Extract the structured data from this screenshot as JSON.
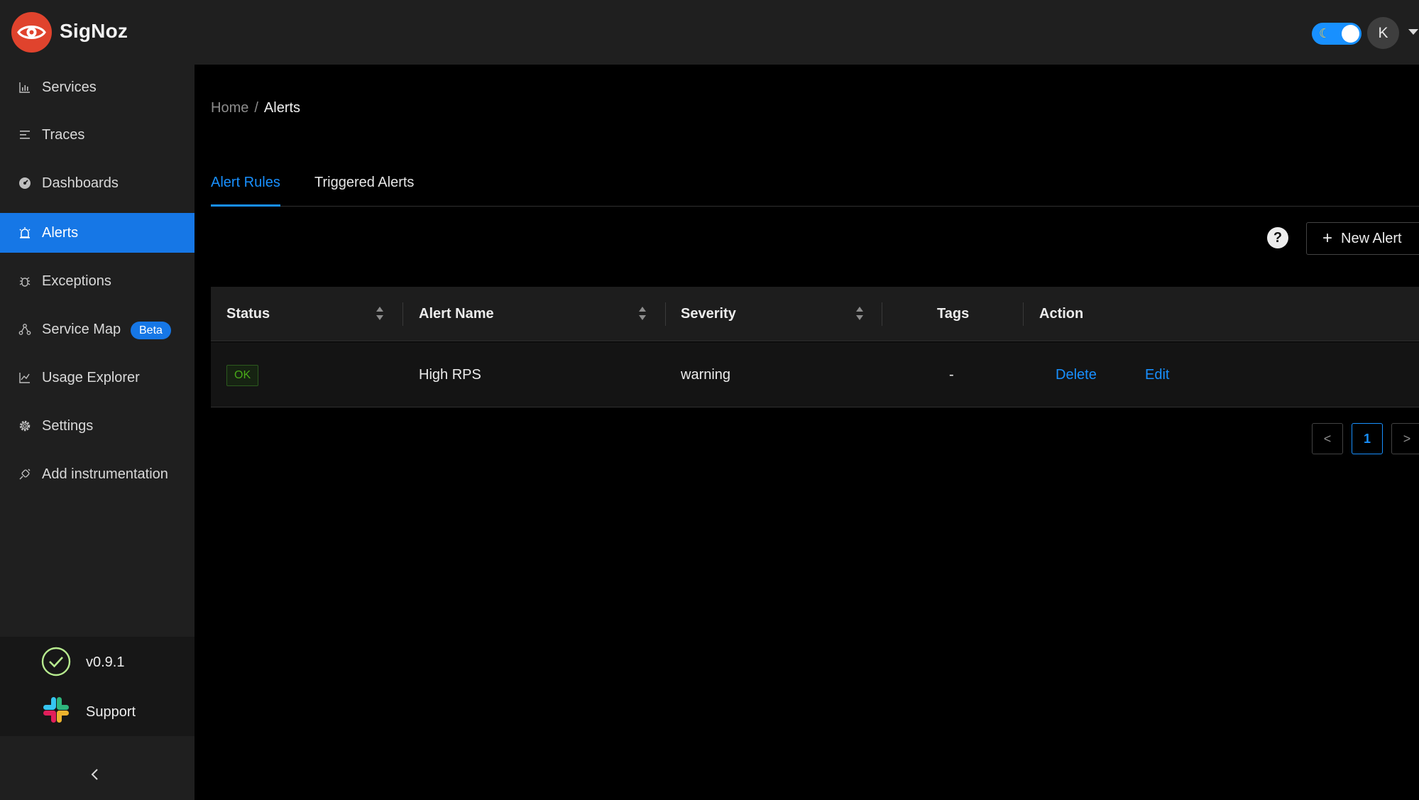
{
  "header": {
    "brand": "SigNoz",
    "avatar_initial": "K",
    "theme_toggle_icon": "moon-icon"
  },
  "sidebar": {
    "items": [
      {
        "label": "Services",
        "icon": "bar-chart-icon",
        "active": false
      },
      {
        "label": "Traces",
        "icon": "align-left-icon",
        "active": false
      },
      {
        "label": "Dashboards",
        "icon": "dashboard-icon",
        "active": false
      },
      {
        "label": "Alerts",
        "icon": "alert-icon",
        "active": true
      },
      {
        "label": "Exceptions",
        "icon": "bug-icon",
        "active": false
      },
      {
        "label": "Service Map",
        "icon": "deployment-unit-icon",
        "active": false,
        "badge": "Beta"
      },
      {
        "label": "Usage Explorer",
        "icon": "line-chart-icon",
        "active": false
      },
      {
        "label": "Settings",
        "icon": "gear-icon",
        "active": false
      },
      {
        "label": "Add instrumentation",
        "icon": "api-icon",
        "active": false
      }
    ],
    "version": "v0.9.1",
    "support": "Support"
  },
  "breadcrumb": {
    "home": "Home",
    "separator": "/",
    "current": "Alerts"
  },
  "tabs": [
    {
      "label": "Alert Rules",
      "active": true
    },
    {
      "label": "Triggered Alerts",
      "active": false
    }
  ],
  "toolbar": {
    "help": "?",
    "new_alert_label": "New Alert"
  },
  "table": {
    "columns": [
      "Status",
      "Alert Name",
      "Severity",
      "Tags",
      "Action"
    ],
    "rows": [
      {
        "status": "OK",
        "alert_name": "High RPS",
        "severity": "warning",
        "tags": "-",
        "actions": [
          "Delete",
          "Edit"
        ]
      }
    ]
  },
  "pagination": {
    "current_page": "1",
    "prev": "<",
    "next": ">"
  },
  "colors": {
    "accent": "#1890ff",
    "brand": "#e0432d",
    "sidebar_bg": "#1f1f1f",
    "ok_green": "#49aa19"
  }
}
